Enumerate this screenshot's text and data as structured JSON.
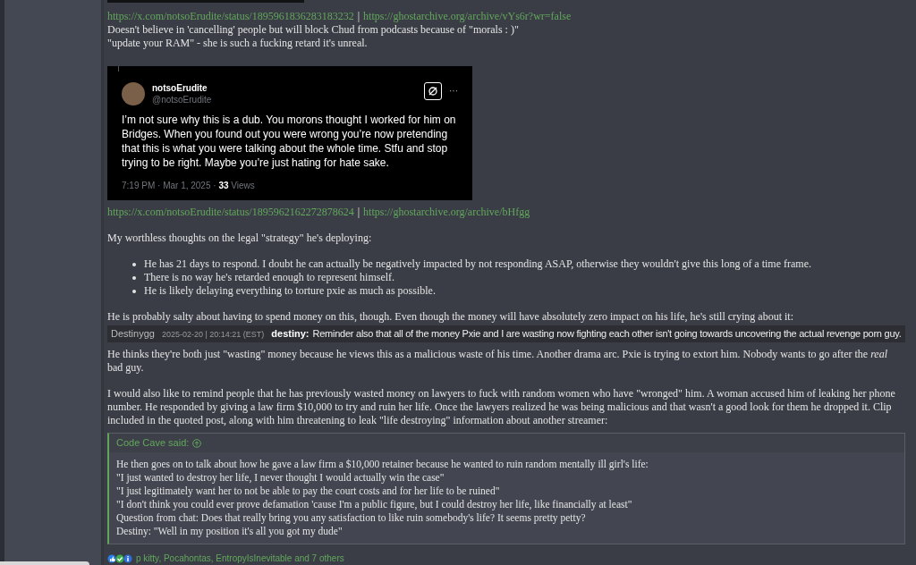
{
  "post": {
    "blocks": [
      {
        "kind": "image_edge"
      },
      {
        "kind": "source",
        "links": [
          "https://x.com/notsoErudite/status/1895961836283183232",
          "https://ghostarchive.org/archive/vYs6r?wr=false"
        ],
        "separator": "|",
        "lines": [
          "Doesn't believe in 'cancelling' people but will block Chud from podcasts because of \"morals : )\"",
          "\"update your RAM\" - she is such a fucking retard it's unreal."
        ]
      },
      {
        "kind": "tweet",
        "name": "notsoErudite",
        "handle": "@notsoErudite",
        "text": "I’m not sure why this is a dub. You morons thought I worked for him on Bridges. When you found out you were wrong you’re now pretending that this is what you were talking about the whole time. Stfu and stop trying to be right. Maybe you’re just hating for hate sake.",
        "more": "···",
        "meta": "7:19 PM · Mar 1, 2025 · **33** Views"
      },
      {
        "kind": "source",
        "links": [
          "https://x.com/notsoErudite/status/1895962162272878624",
          "https://ghostarchive.org/archive/bHfgg"
        ],
        "separator": "|"
      },
      {
        "kind": "text",
        "text": "My worthless thoughts on the legal \"strategy\" he's deploying:"
      },
      {
        "kind": "list",
        "items": [
          "He has 21 days to respond. I doubt he can actually be negatively impacted by not responding ASAP, otherwise they wouldn't give this long of a time frame.",
          "There is no way he's retarded enough to represent himself.",
          "He is likely delaying everything to torture pxie as much as possible."
        ]
      },
      {
        "kind": "text",
        "text": "He is probably salty about having to spend money on this, though. Even though the money will have absolutely zero impact on his life, he's still crying about it:"
      },
      {
        "kind": "chat",
        "channel": "Destinygg",
        "timestamp": "2025-02-20 | 20:14:21 (EST)",
        "author": "destiny:",
        "message": "Reminder also that all of the money Pxie and I are wasting now fighting each other isn't going towards uncovering the actual revenge porn guy."
      },
      {
        "kind": "text",
        "text": "He thinks they're both just \"wasting\" money because he views this as a malicious waste of his time. Another drama arc. Pxie is trying to extort him. Nobody wants to go after the *real* bad guy."
      },
      {
        "kind": "text",
        "text": "I would also like to remind people that he has previously wasted money on lawyers to fuck with random women who have \"wronged\" him. A woman accused him of leaking her phone number. He responded by giving a law firm $10,000 to try and ruin her life. Once the lawyers realized he was being malicious and that wasn't a good look for them he dropped it. Clip included in the quoted post, along with him threatening to leak \"life destroying\" information about another streamer:"
      },
      {
        "kind": "quote",
        "author": "Code Cave said:",
        "lines": [
          "He then goes on to talk about how he gave a law firm a $10,000 retainer because he wanted to ruin random mentally ill girl's life:",
          "\"I just wanted to destroy her life, I never thought I would actually win the case\"",
          "\"I just legitimately want her to not be able to pay the court costs and for her life to be ruined\"",
          "\"I don't think you could ever prove defamation 'cause I'm a public figure, but I could destroy her life, like financially at least\"",
          "Question from chat: Does that really bring you any satisfaction to like ruin somebody's life? It seems pretty petty?",
          "Destiny: \"Well in my position it's all you got my dude\""
        ]
      },
      {
        "kind": "reactions",
        "names": "p kitty, Pocahontas, EntropyIsInevitable and 7 others"
      }
    ]
  }
}
